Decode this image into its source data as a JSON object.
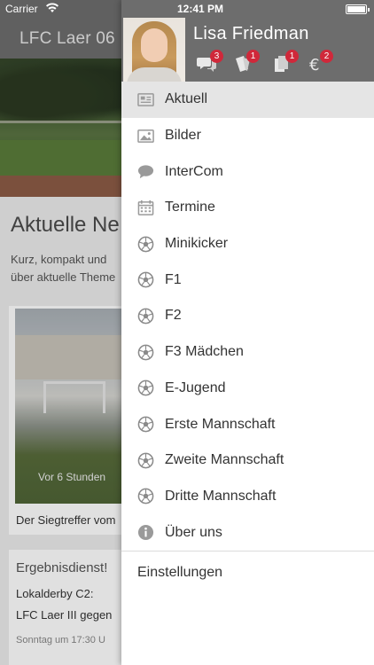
{
  "status_bar": {
    "carrier": "Carrier",
    "time": "12:41 PM"
  },
  "background": {
    "nav_title": "LFC Laer 06",
    "headline": "Aktuelle Ne",
    "intro_line1": "Kurz, kompakt und",
    "intro_line2": "über aktuelle Theme",
    "card1_time": "Vor 6 Stunden",
    "card1_caption": "Der Siegtreffer vom",
    "card2_title": "Ergebnisdienst!",
    "card2_line1": "Lokalderby C2:",
    "card2_line2": "LFC Laer III gegen",
    "card2_meta": "Sonntag um 17:30 U"
  },
  "drawer": {
    "user_name": "Lisa Friedman",
    "header_icons": [
      {
        "icon": "chat-bubbles-icon",
        "badge": "3"
      },
      {
        "icon": "cards-icon",
        "badge": "1"
      },
      {
        "icon": "documents-icon",
        "badge": "1"
      },
      {
        "icon": "euro-icon",
        "badge": "2"
      }
    ],
    "menu": [
      {
        "label": "Aktuell",
        "icon": "newspaper-icon",
        "active": true
      },
      {
        "label": "Bilder",
        "icon": "image-icon"
      },
      {
        "label": "InterCom",
        "icon": "speech-bubble-icon"
      },
      {
        "label": "Termine",
        "icon": "calendar-icon"
      },
      {
        "label": "Minikicker",
        "icon": "soccer-ball-icon"
      },
      {
        "label": "F1",
        "icon": "soccer-ball-icon"
      },
      {
        "label": "F2",
        "icon": "soccer-ball-icon"
      },
      {
        "label": "F3 Mädchen",
        "icon": "soccer-ball-icon"
      },
      {
        "label": "E-Jugend",
        "icon": "soccer-ball-icon"
      },
      {
        "label": "Erste Mannschaft",
        "icon": "soccer-ball-icon"
      },
      {
        "label": "Zweite Mannschaft",
        "icon": "soccer-ball-icon"
      },
      {
        "label": "Dritte Mannschaft",
        "icon": "soccer-ball-icon"
      },
      {
        "label": "Über uns",
        "icon": "info-icon"
      }
    ],
    "settings_label": "Einstellungen"
  },
  "colors": {
    "header_bg": "#6d6d6d",
    "badge": "#d0283a",
    "active_row": "#e5e5e5",
    "icon_gray": "#9a9a9a"
  }
}
